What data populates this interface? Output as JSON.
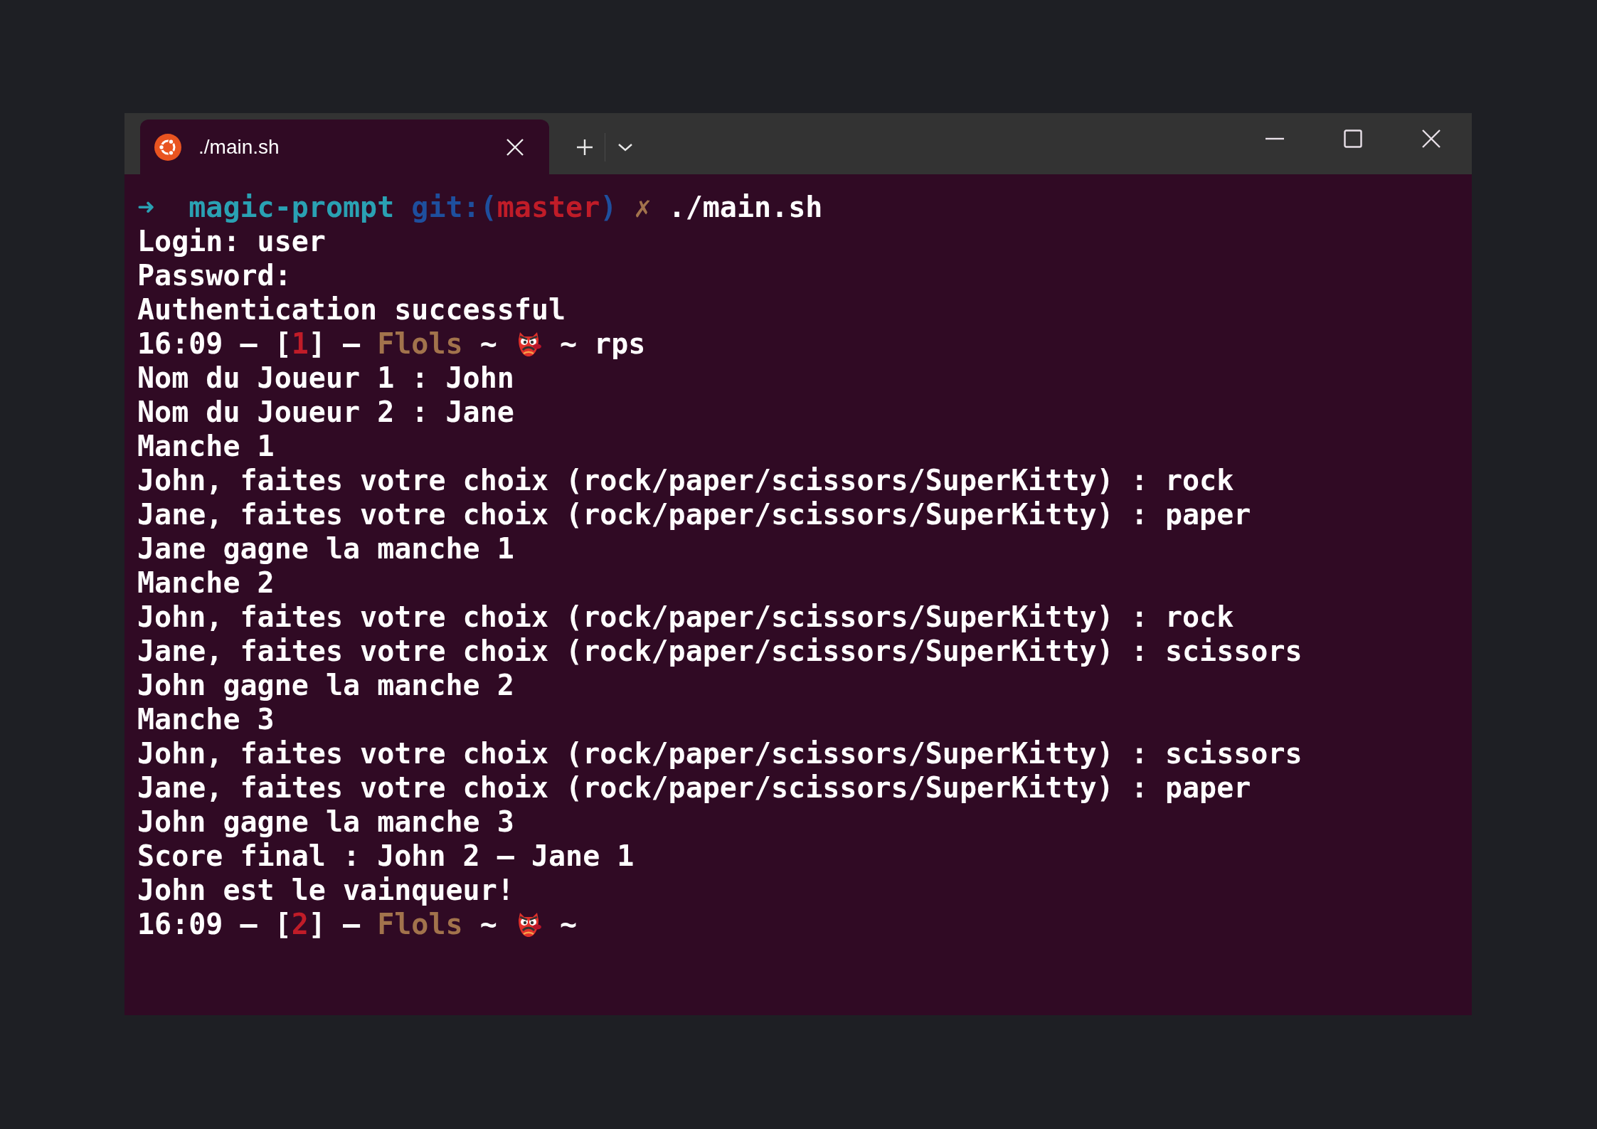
{
  "tabs": [
    {
      "title": "./main.sh",
      "selected": true
    }
  ],
  "lines": [
    {
      "kind": "segments",
      "segments": [
        {
          "kind": "text",
          "text": "➜  ",
          "color": "#2aa1b3"
        },
        {
          "kind": "text",
          "text": "magic-prompt ",
          "color": "#2aa1b3"
        },
        {
          "kind": "text",
          "text": "git:(",
          "color": "#1e4f9e"
        },
        {
          "kind": "text",
          "text": "master",
          "color": "#c01c28"
        },
        {
          "kind": "text",
          "text": ") ",
          "color": "#1e4f9e"
        },
        {
          "kind": "text",
          "text": "✗ ",
          "color": "#a2734c"
        },
        {
          "kind": "text",
          "text": "./main.sh",
          "color": "#ffffff"
        }
      ]
    },
    {
      "kind": "text",
      "text": "Login: user"
    },
    {
      "kind": "text",
      "text": "Password:"
    },
    {
      "kind": "text",
      "text": "Authentication successful"
    },
    {
      "kind": "segments",
      "segments": [
        {
          "kind": "text",
          "text": "16:09 – [",
          "color": "#ffffff"
        },
        {
          "kind": "text",
          "text": "1",
          "color": "#c01c28"
        },
        {
          "kind": "text",
          "text": "] – ",
          "color": "#ffffff"
        },
        {
          "kind": "text",
          "text": "Flols",
          "color": "#a2734c"
        },
        {
          "kind": "text",
          "text": " ~ ",
          "color": "#ffffff"
        },
        {
          "kind": "icon"
        },
        {
          "kind": "text",
          "text": " ~ rps",
          "color": "#ffffff"
        }
      ]
    },
    {
      "kind": "text",
      "text": "Nom du Joueur 1 : John"
    },
    {
      "kind": "text",
      "text": "Nom du Joueur 2 : Jane"
    },
    {
      "kind": "text",
      "text": "Manche 1"
    },
    {
      "kind": "text",
      "text": "John, faites votre choix (rock/paper/scissors/SuperKitty) : rock"
    },
    {
      "kind": "text",
      "text": "Jane, faites votre choix (rock/paper/scissors/SuperKitty) : paper"
    },
    {
      "kind": "text",
      "text": "Jane gagne la manche 1"
    },
    {
      "kind": "text",
      "text": "Manche 2"
    },
    {
      "kind": "text",
      "text": "John, faites votre choix (rock/paper/scissors/SuperKitty) : rock"
    },
    {
      "kind": "text",
      "text": "Jane, faites votre choix (rock/paper/scissors/SuperKitty) : scissors"
    },
    {
      "kind": "text",
      "text": "John gagne la manche 2"
    },
    {
      "kind": "text",
      "text": "Manche 3"
    },
    {
      "kind": "text",
      "text": "John, faites votre choix (rock/paper/scissors/SuperKitty) : scissors"
    },
    {
      "kind": "text",
      "text": "Jane, faites votre choix (rock/paper/scissors/SuperKitty) : paper"
    },
    {
      "kind": "text",
      "text": "John gagne la manche 3"
    },
    {
      "kind": "text",
      "text": "Score final : John 2 – Jane 1"
    },
    {
      "kind": "text",
      "text": "John est le vainqueur!"
    },
    {
      "kind": "segments",
      "segments": [
        {
          "kind": "text",
          "text": "16:09 – [",
          "color": "#ffffff"
        },
        {
          "kind": "text",
          "text": "2",
          "color": "#c01c28"
        },
        {
          "kind": "text",
          "text": "] – ",
          "color": "#ffffff"
        },
        {
          "kind": "text",
          "text": "Flols",
          "color": "#a2734c"
        },
        {
          "kind": "text",
          "text": " ~ ",
          "color": "#ffffff"
        },
        {
          "kind": "icon"
        },
        {
          "kind": "text",
          "text": " ~",
          "color": "#ffffff"
        }
      ]
    }
  ]
}
